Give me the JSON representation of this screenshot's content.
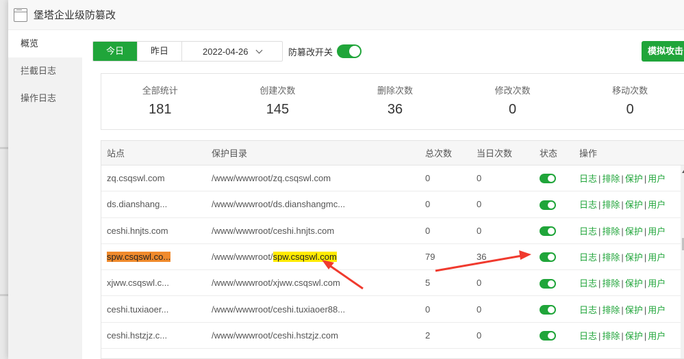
{
  "dialog": {
    "title": "堡塔企业级防篡改"
  },
  "sidebar": {
    "items": [
      {
        "label": "概览",
        "active": true
      },
      {
        "label": "拦截日志",
        "active": false
      },
      {
        "label": "操作日志",
        "active": false
      }
    ]
  },
  "toolbar": {
    "today": "今日",
    "yesterday": "昨日",
    "date": "2022-04-26",
    "switch_label": "防篡改开关",
    "switch_on": true,
    "attack_button": "模拟攻击"
  },
  "stats": [
    {
      "label": "全部统计",
      "value": "181"
    },
    {
      "label": "创建次数",
      "value": "145"
    },
    {
      "label": "删除次数",
      "value": "36"
    },
    {
      "label": "修改次数",
      "value": "0"
    },
    {
      "label": "移动次数",
      "value": "0"
    }
  ],
  "table": {
    "headers": {
      "site": "站点",
      "dir": "保护目录",
      "total": "总次数",
      "today": "当日次数",
      "status": "状态",
      "ops": "操作"
    },
    "ops": {
      "log": "日志",
      "exclude": "排除",
      "protect": "保护",
      "user": "用户",
      "sep": "|"
    },
    "rows": [
      {
        "site": "zq.csqswl.com",
        "dir_prefix": "/www/wwwroot/zq.csqswl.com",
        "dir_hl": "",
        "total": "0",
        "today": "0",
        "status": "on"
      },
      {
        "site": "ds.dianshang...",
        "dir_prefix": "/www/wwwroot/ds.dianshangmc...",
        "dir_hl": "",
        "total": "0",
        "today": "0",
        "status": "on"
      },
      {
        "site": "ceshi.hnjts.com",
        "dir_prefix": "/www/wwwroot/ceshi.hnjts.com",
        "dir_hl": "",
        "total": "0",
        "today": "0",
        "status": "on"
      },
      {
        "site": "spw.csqswl.co...",
        "dir_prefix": "/www/wwwroot/",
        "dir_hl": "spw.csqswl.com",
        "total": "79",
        "today": "36",
        "status": "on"
      },
      {
        "site": "xjww.csqswl.c...",
        "dir_prefix": "/www/wwwroot/xjww.csqswl.com",
        "dir_hl": "",
        "total": "5",
        "today": "0",
        "status": "on"
      },
      {
        "site": "ceshi.tuxiaoer...",
        "dir_prefix": "/www/wwwroot/ceshi.tuxiaoer88...",
        "dir_hl": "",
        "total": "0",
        "today": "0",
        "status": "on"
      },
      {
        "site": "ceshi.hstzjz.c...",
        "dir_prefix": "/www/wwwroot/ceshi.hstzjz.com",
        "dir_hl": "",
        "total": "2",
        "today": "0",
        "status": "on"
      }
    ]
  },
  "colors": {
    "accent": "#20a53a",
    "highlight_orange": "#f08a2c",
    "highlight_yellow": "#ffeb00",
    "annotation_arrow": "#f03a2e"
  }
}
